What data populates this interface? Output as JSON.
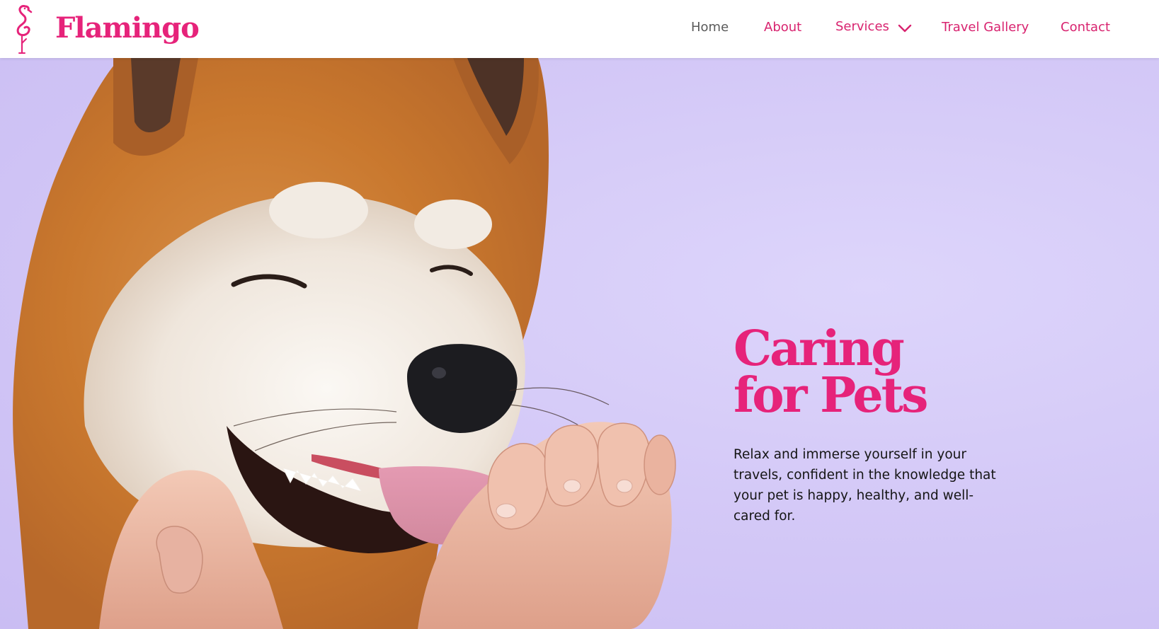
{
  "brand": {
    "name": "Flamingo",
    "color": "#e6237a",
    "logo_icon": "flamingo-icon"
  },
  "nav": {
    "home": "Home",
    "about": "About",
    "services": "Services",
    "travel_gallery": "Travel Gallery",
    "contact": "Contact",
    "active_color": "#5a5a5a",
    "link_color": "#d8236f",
    "dropdown_icon": "chevron-down-icon"
  },
  "hero": {
    "title_line1": "Caring",
    "title_line2": "for Pets",
    "description": "Relax and immerse yourself in your travels, confident in the knowledge that your pet is happy, healthy, and well-cared for.",
    "background_color": "#d4c9f7",
    "image": "shiba-inu-dog-photo"
  }
}
